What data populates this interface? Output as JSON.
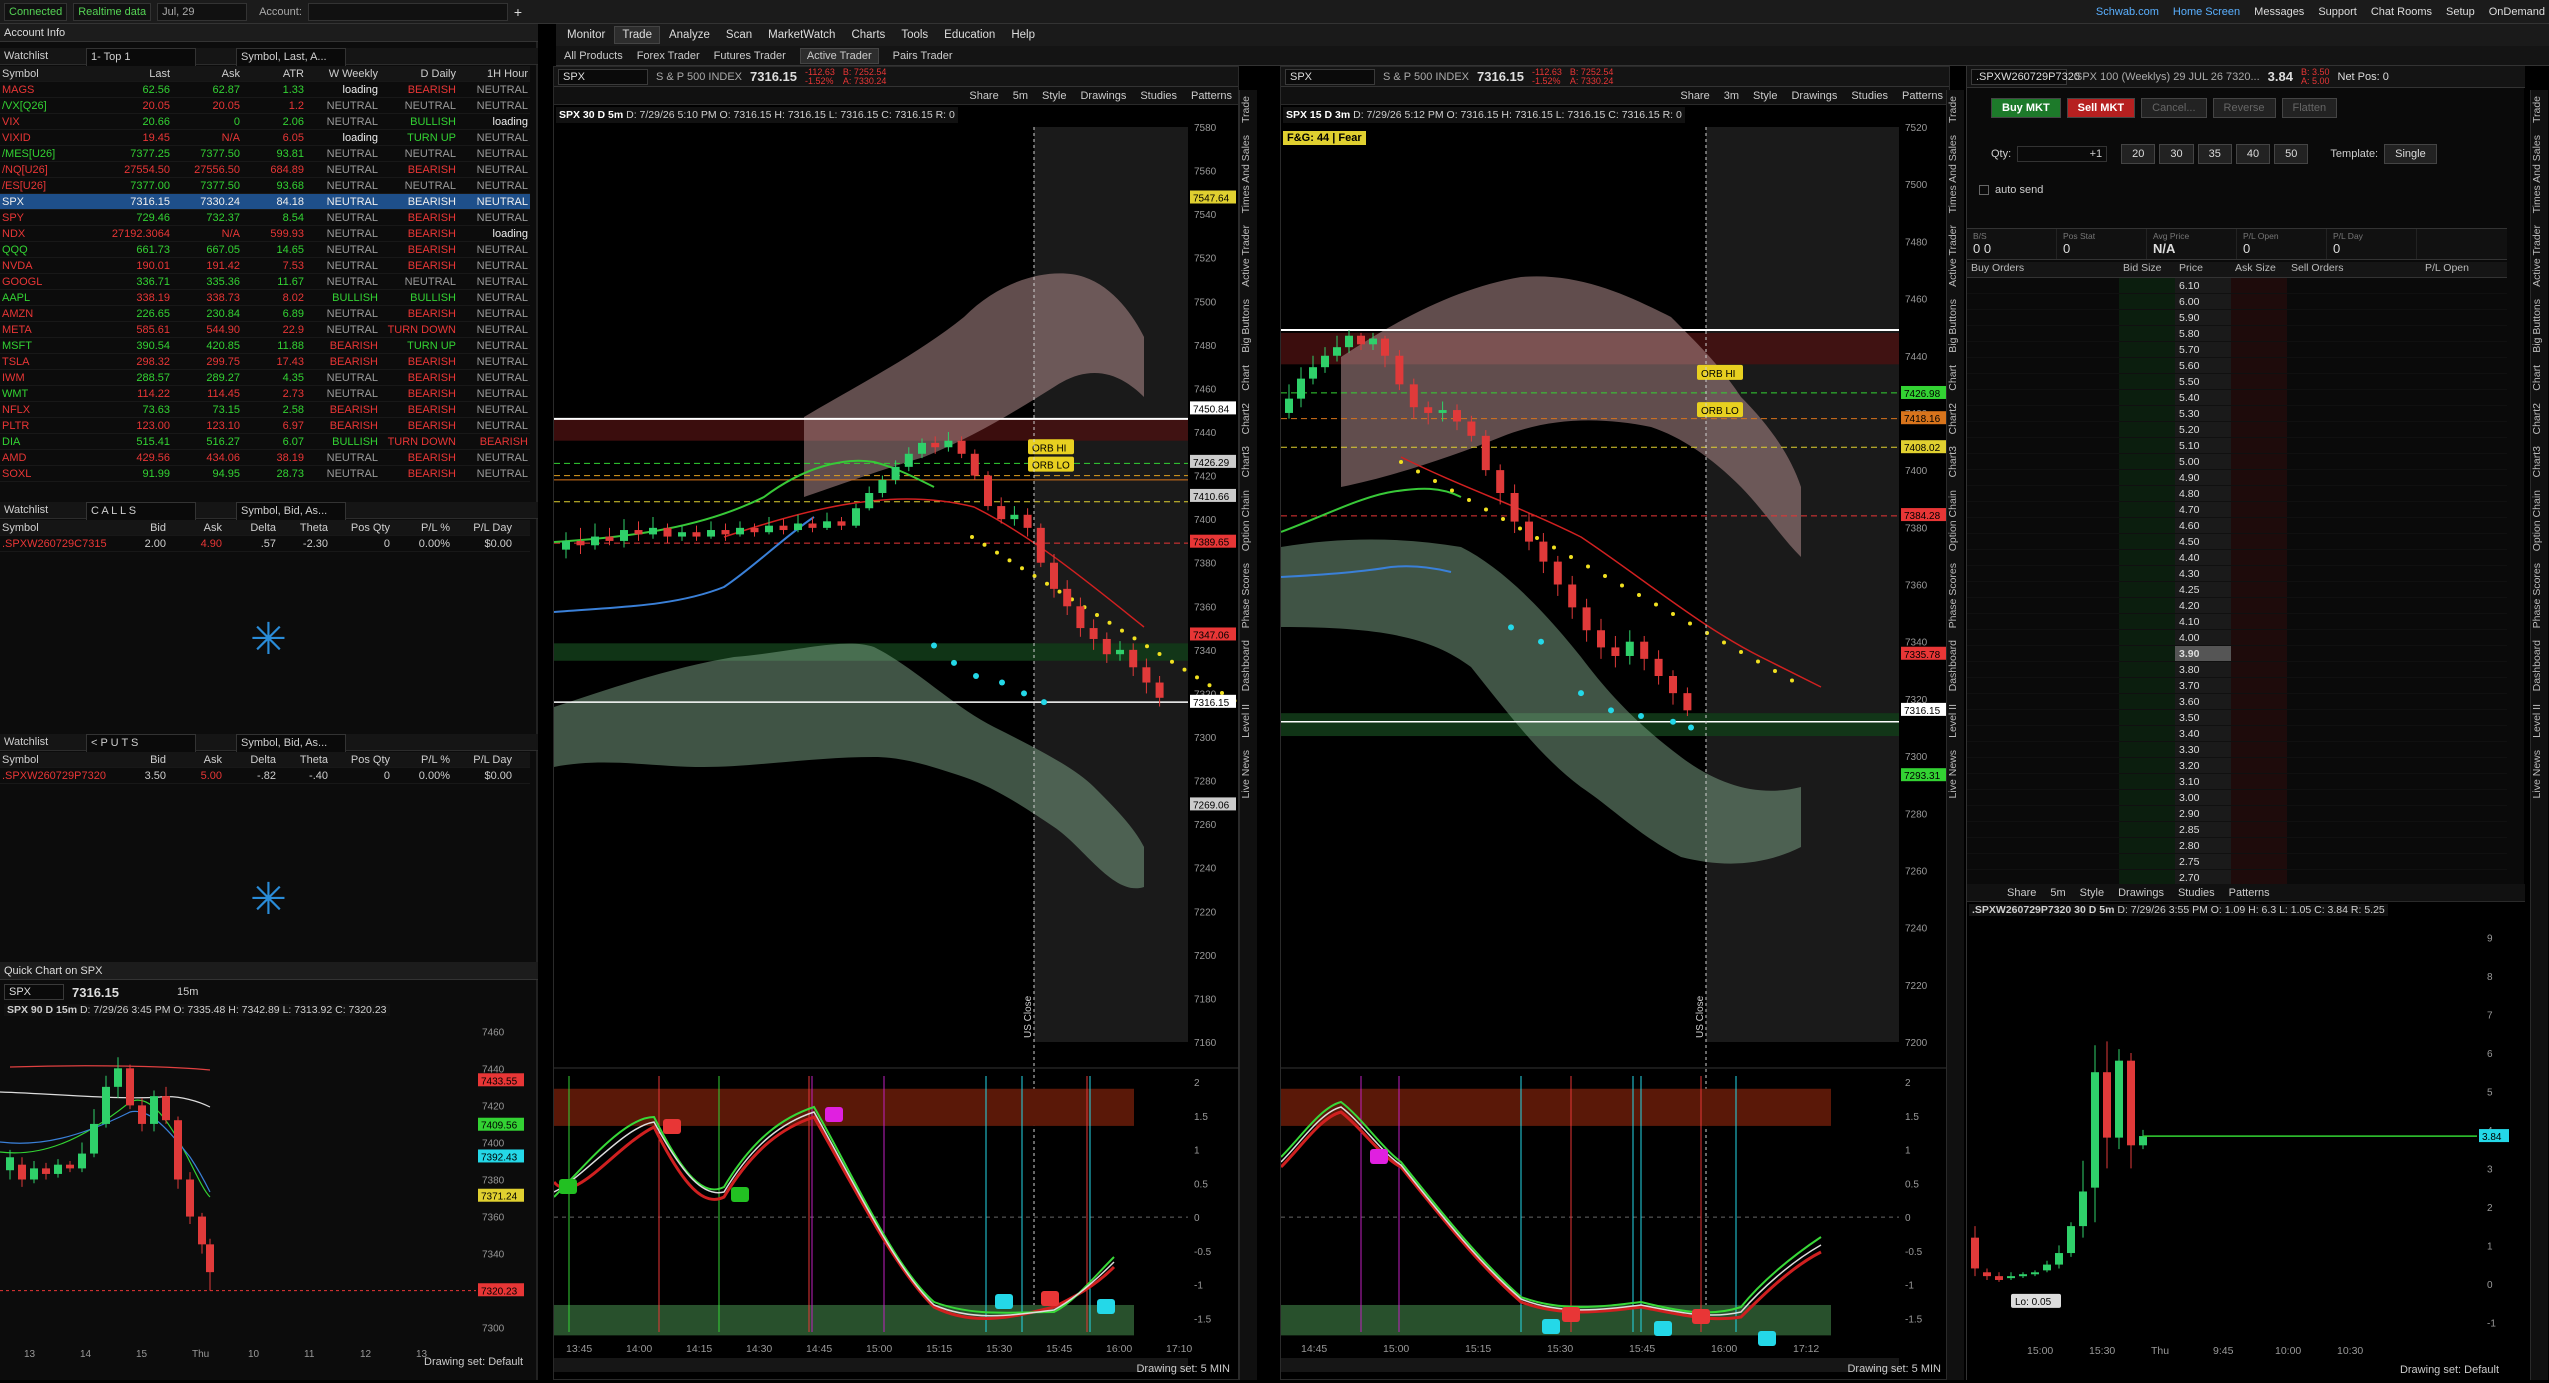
{
  "topbar": {
    "status": "Connected",
    "realtime": "Realtime data",
    "date": "Jul, 29",
    "account_label": "Account:",
    "links": [
      "Schwab.com",
      "Home Screen",
      "Messages",
      "Support",
      "Chat Rooms",
      "Setup"
    ],
    "ondemand": "OnDemand"
  },
  "left": {
    "account_info": "Account Info",
    "wl1": {
      "label": "Watchlist",
      "name": "1- Top 1",
      "cols_label": "Symbol, Last, A...",
      "headers": [
        "Symbol",
        "Last",
        "Ask",
        "ATR",
        "W Weekly",
        "D Daily",
        "1H Hour"
      ],
      "rows": [
        [
          "MAGS",
          "62.56",
          "62.87",
          "1.33",
          "loading",
          "BEARISH",
          "NEUTRAL"
        ],
        [
          "/VX[Q26]",
          "20.05",
          "20.05",
          "1.2",
          "NEUTRAL",
          "NEUTRAL",
          "NEUTRAL"
        ],
        [
          "VIX",
          "20.66",
          "0",
          "2.06",
          "NEUTRAL",
          "BULLISH",
          "loading"
        ],
        [
          "VIXID",
          "19.45",
          "N/A",
          "6.05",
          "loading",
          "TURN UP",
          "NEUTRAL"
        ],
        [
          "/MES[U26]",
          "7377.25",
          "7377.50",
          "93.81",
          "NEUTRAL",
          "NEUTRAL",
          "NEUTRAL"
        ],
        [
          "/NQ[U26]",
          "27554.50",
          "27556.50",
          "684.89",
          "NEUTRAL",
          "BEARISH",
          "NEUTRAL"
        ],
        [
          "/ES[U26]",
          "7377.00",
          "7377.50",
          "93.68",
          "NEUTRAL",
          "NEUTRAL",
          "NEUTRAL"
        ],
        [
          "SPX",
          "7316.15",
          "7330.24",
          "84.18",
          "NEUTRAL",
          "BEARISH",
          "NEUTRAL"
        ],
        [
          "SPY",
          "729.46",
          "732.37",
          "8.54",
          "NEUTRAL",
          "BEARISH",
          "NEUTRAL"
        ],
        [
          "NDX",
          "27192.3064",
          "N/A",
          "599.93",
          "NEUTRAL",
          "BEARISH",
          "loading"
        ],
        [
          "QQQ",
          "661.73",
          "667.05",
          "14.65",
          "NEUTRAL",
          "BEARISH",
          "NEUTRAL"
        ],
        [
          "NVDA",
          "190.01",
          "191.42",
          "7.53",
          "NEUTRAL",
          "BEARISH",
          "NEUTRAL"
        ],
        [
          "GOOGL",
          "336.71",
          "335.36",
          "11.67",
          "NEUTRAL",
          "NEUTRAL",
          "NEUTRAL"
        ],
        [
          "AAPL",
          "338.19",
          "338.73",
          "8.02",
          "BULLISH",
          "BULLISH",
          "NEUTRAL"
        ],
        [
          "AMZN",
          "226.65",
          "230.84",
          "6.89",
          "NEUTRAL",
          "BEARISH",
          "NEUTRAL"
        ],
        [
          "META",
          "585.61",
          "544.90",
          "22.9",
          "NEUTRAL",
          "TURN DOWN",
          "NEUTRAL"
        ],
        [
          "MSFT",
          "390.54",
          "420.85",
          "11.88",
          "BEARISH",
          "TURN UP",
          "NEUTRAL"
        ],
        [
          "TSLA",
          "298.32",
          "299.75",
          "17.43",
          "BEARISH",
          "BEARISH",
          "NEUTRAL"
        ],
        [
          "IWM",
          "288.57",
          "289.27",
          "4.35",
          "NEUTRAL",
          "BEARISH",
          "NEUTRAL"
        ],
        [
          "WMT",
          "114.22",
          "114.45",
          "2.73",
          "NEUTRAL",
          "BEARISH",
          "NEUTRAL"
        ],
        [
          "NFLX",
          "73.63",
          "73.15",
          "2.58",
          "BEARISH",
          "BEARISH",
          "NEUTRAL"
        ],
        [
          "PLTR",
          "123.00",
          "123.10",
          "6.97",
          "BEARISH",
          "BEARISH",
          "NEUTRAL"
        ],
        [
          "DIA",
          "515.41",
          "516.27",
          "6.07",
          "BULLISH",
          "TURN DOWN",
          "BEARISH"
        ],
        [
          "AMD",
          "429.56",
          "434.06",
          "38.19",
          "NEUTRAL",
          "BEARISH",
          "NEUTRAL"
        ],
        [
          "SOXL",
          "91.99",
          "94.95",
          "28.73",
          "NEUTRAL",
          "BEARISH",
          "NEUTRAL"
        ]
      ]
    },
    "wl2": {
      "label": "Watchlist",
      "name": "C A L L S",
      "cols_label": "Symbol, Bid, As...",
      "headers": [
        "Symbol",
        "Bid",
        "Ask",
        "Delta",
        "Theta",
        "Pos Qty",
        "P/L %",
        "P/L Day"
      ],
      "rows": [
        [
          ".SPXW260729C7315",
          "2.00",
          "4.90",
          ".57",
          "-2.30",
          "0",
          "0.00%",
          "$0.00"
        ]
      ]
    },
    "wl3": {
      "label": "Watchlist",
      "name": "< P U T S",
      "cols_label": "Symbol, Bid, As...",
      "headers": [
        "Symbol",
        "Bid",
        "Ask",
        "Delta",
        "Theta",
        "Pos Qty",
        "P/L %",
        "P/L Day"
      ],
      "rows": [
        [
          ".SPXW260729P7320",
          "3.50",
          "5.00",
          "-.82",
          "-.40",
          "0",
          "0.00%",
          "$0.00"
        ]
      ]
    },
    "quick": {
      "title": "Quick Chart on SPX",
      "symbol": "SPX",
      "last": "7316.15",
      "interval": "15m",
      "info": "SPX 90 D 15m",
      "date": "D: 7/29/26 3:45 PM",
      "o": "O: 7335.48",
      "h": "H: 7342.89",
      "l": "L: 7313.92",
      "c": "C: 7320.23",
      "xlabels": [
        "13",
        "14",
        "15",
        "Thu",
        "10",
        "11",
        "12",
        "13"
      ],
      "ylabels": [
        "7460",
        "7440",
        "7420",
        "7400",
        "7380",
        "7360",
        "7340",
        "7320",
        "7300"
      ],
      "boxes": [
        "7433.55",
        "7409.56",
        "7392.43",
        "7371.24",
        "7320.23"
      ],
      "drawset": "Drawing set: Default"
    }
  },
  "menu": {
    "items": [
      "Monitor",
      "Trade",
      "Analyze",
      "Scan",
      "MarketWatch",
      "Charts",
      "Tools",
      "Education",
      "Help"
    ],
    "active": "Trade",
    "sub": [
      "All Products",
      "Forex Trader",
      "Futures Trader",
      "Active Trader",
      "Pairs Trader"
    ],
    "sub_active": "Active Trader"
  },
  "chart1": {
    "symbol": "SPX",
    "name": "S & P 500 INDEX",
    "last": "7316.15",
    "chg": "-112.63",
    "chgpct": "-1.52%",
    "bid": "B: 7252.54",
    "ask": "A: 7330.24",
    "title": "SPX 30 D 5m",
    "date": "D: 7/29/26 5:10 PM",
    "o": "O: 7316.15",
    "h": "H: 7316.15",
    "l": "L: 7316.15",
    "c": "C: 7316.15",
    "r": "R: 0",
    "tools": [
      "Share",
      "5m",
      "Style",
      "Drawings",
      "Studies",
      "Patterns"
    ],
    "yaxis": [
      "7580",
      "7560",
      "7540",
      "7520",
      "7500",
      "7480",
      "7460",
      "7440",
      "7420",
      "7400",
      "7380",
      "7360",
      "7340",
      "7320",
      "7300",
      "7280",
      "7260",
      "7240",
      "7220",
      "7200",
      "7180",
      "7160"
    ],
    "boxes": [
      {
        "v": "7547.64",
        "c": "#e0d030"
      },
      {
        "v": "7450.84",
        "c": "#ffffff"
      },
      {
        "v": "7426.29",
        "c": "#cccccc"
      },
      {
        "v": "7410.66",
        "c": "#cccccc"
      },
      {
        "v": "7389.65",
        "c": "#e83636"
      },
      {
        "v": "7347.06",
        "c": "#e83636"
      },
      {
        "v": "7316.15",
        "c": "#ffffff"
      },
      {
        "v": "7269.06",
        "c": "#cccccc"
      }
    ],
    "xaxis": [
      "13:45",
      "14:00",
      "14:15",
      "14:30",
      "14:45",
      "15:00",
      "15:15",
      "15:30",
      "15:45",
      "16:00",
      "17:10"
    ],
    "orb_hi": "ORB HI",
    "orb_lo": "ORB LO",
    "us_close": "US Close",
    "osc_y": [
      "2",
      "1.5",
      "1",
      "0.5",
      "0",
      "-0.5",
      "-1",
      "-1.5"
    ],
    "drawset": "Drawing set: 5 MIN"
  },
  "chart2": {
    "symbol": "SPX",
    "name": "S & P 500 INDEX",
    "last": "7316.15",
    "chg": "-112.63",
    "chgpct": "-1.52%",
    "bid": "B: 7252.54",
    "ask": "A: 7330.24",
    "title": "SPX 15 D 3m",
    "date": "D: 7/29/26 5:12 PM",
    "o": "O: 7316.15",
    "h": "H: 7316.15",
    "l": "L: 7316.15",
    "c": "C: 7316.15",
    "r": "R: 0",
    "fng": "F&G: 44 | Fear",
    "tools": [
      "Share",
      "3m",
      "Style",
      "Drawings",
      "Studies",
      "Patterns"
    ],
    "yaxis": [
      "7520",
      "7500",
      "7480",
      "7460",
      "7440",
      "7420",
      "7400",
      "7380",
      "7360",
      "7340",
      "7320",
      "7300",
      "7280",
      "7260",
      "7240",
      "7220",
      "7200"
    ],
    "boxes": [
      {
        "v": "7426.98",
        "c": "#33d233"
      },
      {
        "v": "7418.16",
        "c": "#d8741c"
      },
      {
        "v": "7408.02",
        "c": "#e0d030"
      },
      {
        "v": "7384.28",
        "c": "#e83636"
      },
      {
        "v": "7335.78",
        "c": "#e83636"
      },
      {
        "v": "7316.15",
        "c": "#ffffff"
      },
      {
        "v": "7293.31",
        "c": "#33d233"
      }
    ],
    "xaxis": [
      "14:45",
      "15:00",
      "15:15",
      "15:30",
      "15:45",
      "16:00",
      "17:12"
    ],
    "orb_hi": "ORB HI",
    "orb_lo": "ORB LO",
    "us_close": "US Close",
    "osc_y": [
      "2",
      "1.5",
      "1",
      "0.5",
      "0",
      "-0.5",
      "-1",
      "-1.5"
    ],
    "drawset": "Drawing set: 5 MIN"
  },
  "sidetabs1": [
    "Trade",
    "Times And Sales",
    "Active Trader",
    "Big Buttons",
    "Chart",
    "Chart2",
    "Chart3",
    "Option Chain",
    "Phase Scores",
    "Dashboard",
    "Level II",
    "Live News"
  ],
  "at": {
    "symbol": ".SPXW260729P7320",
    "desc": "SPX 100 (Weeklys) 29 JUL 26 7320...",
    "last": "3.84",
    "bid": "B: 3.50",
    "ask": "A: 5.00",
    "netpos": "Net Pos: 0",
    "buy": "Buy MKT",
    "sell": "Sell MKT",
    "cancel": "Cancel...",
    "reverse": "Reverse",
    "flatten": "Flatten",
    "qty_label": "Qty:",
    "qty": "+1",
    "qtybtns": [
      "20",
      "30",
      "35",
      "40",
      "50"
    ],
    "template_label": "Template:",
    "template": "Single",
    "autosend": "auto send",
    "stats": [
      {
        "l": "B/S",
        "v": "0 0"
      },
      {
        "l": "Pos Stat",
        "v": "0"
      },
      {
        "l": "Avg Price",
        "v": "N/A"
      },
      {
        "l": "P/L Open",
        "v": "0"
      },
      {
        "l": "P/L Day",
        "v": "0"
      }
    ],
    "ladder_hdr": [
      "Buy Orders",
      "Bid Size",
      "Price",
      "Ask Size",
      "Sell Orders",
      "P/L Open"
    ],
    "prices": [
      "6.10",
      "6.00",
      "5.90",
      "5.80",
      "5.70",
      "5.60",
      "5.50",
      "5.40",
      "5.30",
      "5.20",
      "5.10",
      "5.00",
      "4.90",
      "4.80",
      "4.70",
      "4.60",
      "4.50",
      "4.40",
      "4.30",
      "4.25",
      "4.20",
      "4.10",
      "4.00",
      "3.90",
      "3.80",
      "3.70",
      "3.60",
      "3.50",
      "3.40",
      "3.30",
      "3.20",
      "3.10",
      "3.00",
      "2.90",
      "2.85",
      "2.80",
      "2.75",
      "2.70"
    ],
    "current": "3.90",
    "chart": {
      "title": ".SPXW260729P7320 30 D 5m",
      "date": "D: 7/29/26 3:55 PM",
      "o": "O: 1.09",
      "h": "H: 6.3",
      "l": "L: 1.05",
      "c": "C: 3.84",
      "r": "R: 5.25",
      "interval": "5m",
      "yaxis": [
        "9",
        "8",
        "7",
        "6",
        "5",
        "4",
        "3",
        "2",
        "1",
        "0",
        "-1"
      ],
      "xaxis": [
        "15:00",
        "15:30",
        "Thu",
        "9:45",
        "10:00",
        "10:30"
      ],
      "lo": "Lo: 0.05",
      "box": "3.84",
      "drawset": "Drawing set: Default"
    }
  },
  "sidetabs2": [
    "Trade",
    "Times And Sales",
    "Active Trader",
    "Big Buttons",
    "Chart",
    "Chart2",
    "Chart3",
    "Option Chain",
    "Phase Scores",
    "Dashboard",
    "Level II",
    "Live News"
  ]
}
